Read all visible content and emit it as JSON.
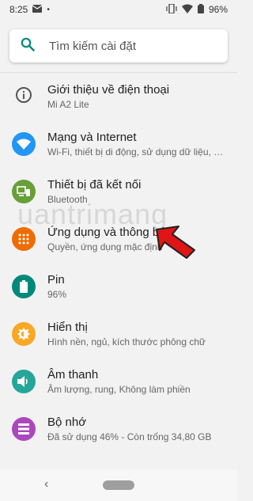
{
  "status_bar": {
    "time": "8:25",
    "battery": "96%"
  },
  "search": {
    "placeholder": "Tìm kiếm cài đặt"
  },
  "items": [
    {
      "title": "Giới thiệu về điện thoại",
      "subtitle": "Mi A2 Lite",
      "icon": "info-icon",
      "color": ""
    },
    {
      "title": "Mạng và Internet",
      "subtitle": "Wi-Fi, thiết bị di động, sử dụng dữ liệu, điểm...",
      "icon": "wifi-icon",
      "color": "#2196f3"
    },
    {
      "title": "Thiết bị đã kết nối",
      "subtitle": "Bluetooth",
      "icon": "devices-icon",
      "color": "#689f38"
    },
    {
      "title": "Ứng dụng và thông báo",
      "subtitle": "Quyền, ứng dụng mặc định",
      "icon": "apps-icon",
      "color": "#ef6c00"
    },
    {
      "title": "Pin",
      "subtitle": "96%",
      "icon": "battery-icon",
      "color": "#00897b"
    },
    {
      "title": "Hiển thị",
      "subtitle": "Hình nền, ngủ, kích thước phông chữ",
      "icon": "display-icon",
      "color": "#f9a825"
    },
    {
      "title": "Âm thanh",
      "subtitle": "Âm lượng, rung, Không làm phiền",
      "icon": "sound-icon",
      "color": "#26a69a"
    },
    {
      "title": "Bộ nhớ",
      "subtitle": "Đã sử dụng 46% - Còn trống 34,80 GB",
      "icon": "storage-icon",
      "color": "#ab47bc"
    }
  ],
  "watermark": {
    "text": "uantrimang"
  }
}
